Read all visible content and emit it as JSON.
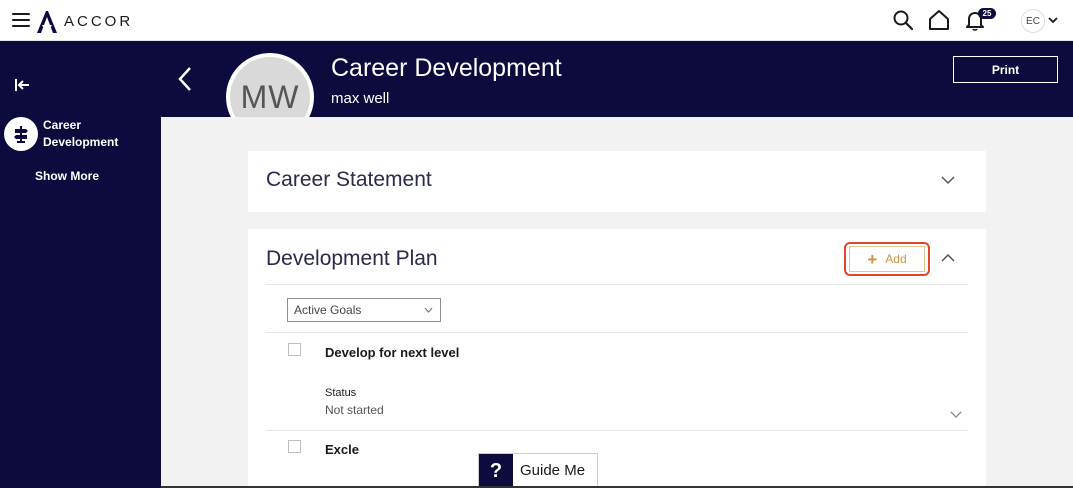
{
  "topbar": {
    "brand": "ACCOR",
    "notification_count": "25",
    "user_initials": "EC"
  },
  "sidebar": {
    "items": [
      {
        "label": "Career Development",
        "icon": "signpost-icon"
      }
    ],
    "show_more": "Show More"
  },
  "header": {
    "avatar_initials": "MW",
    "title": "Career Development",
    "subtitle": "max well",
    "print_label": "Print"
  },
  "career_statement": {
    "title": "Career Statement"
  },
  "development_plan": {
    "title": "Development Plan",
    "add_label": "Add",
    "filter_selected": "Active Goals",
    "goals": [
      {
        "title": "Develop for next level",
        "status_label": "Status",
        "status_value": "Not started"
      },
      {
        "title": "Excle"
      }
    ]
  },
  "guide": {
    "icon_text": "?",
    "label": "Guide Me"
  },
  "colors": {
    "navy": "#0d0b3e",
    "accent_gold": "#c9934a",
    "highlight_red": "#e2462a",
    "background_gray": "#f2f2f2"
  }
}
